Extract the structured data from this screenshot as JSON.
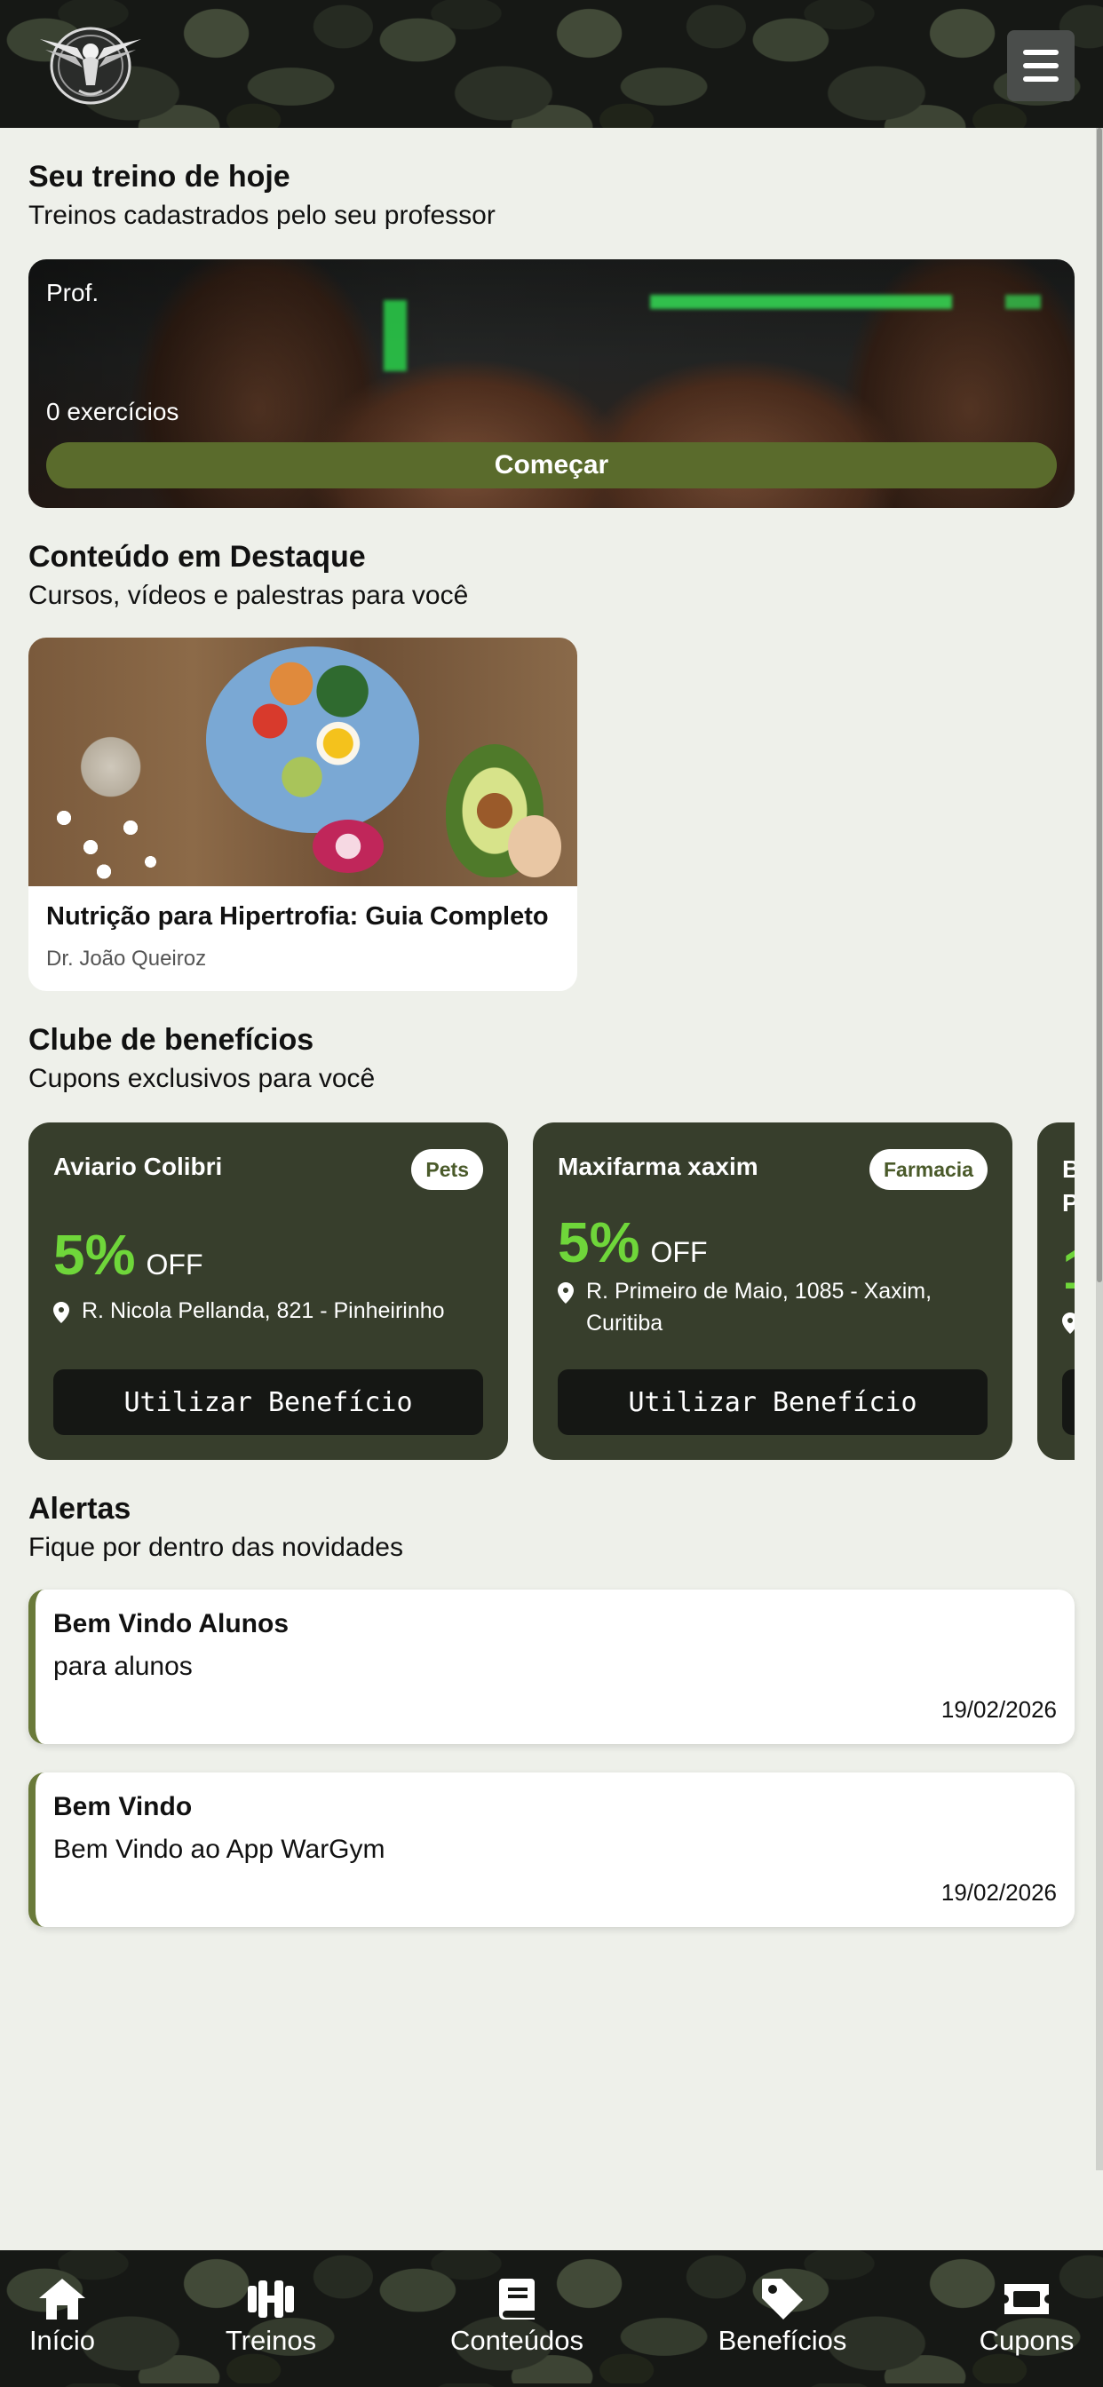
{
  "header": {
    "logo_icon": "eagle-logo-icon",
    "menu_icon": "hamburger-icon"
  },
  "today": {
    "title": "Seu treino de hoje",
    "subtitle": "Treinos cadastrados pelo seu professor",
    "card": {
      "professor": "Prof.",
      "exercises": "0 exercícios",
      "start_label": "Começar"
    }
  },
  "featured": {
    "title": "Conteúdo em Destaque",
    "subtitle": "Cursos, vídeos e palestras para você",
    "items": [
      {
        "title": "Nutrição para Hipertrofia: Guia Completo",
        "author": "Dr. João Queiroz"
      }
    ]
  },
  "benefits": {
    "title": "Clube de benefícios",
    "subtitle": "Cupons exclusivos para você",
    "items": [
      {
        "name": "Aviario Colibri",
        "tag": "Pets",
        "discount": "5%",
        "off": "OFF",
        "address": "R. Nicola Pellanda, 821 - Pinheirinho",
        "button": "Utilizar Benefício"
      },
      {
        "name": "Maxifarma xaxim",
        "tag": "Farmacia",
        "discount": "5%",
        "off": "OFF",
        "address": "R. Primeiro de Maio, 1085 - Xaxim, Curitiba",
        "button": "Utilizar Benefício"
      }
    ],
    "partial_card": {
      "name_line1": "B",
      "name_line2": "P",
      "discount": "1"
    }
  },
  "alerts": {
    "title": "Alertas",
    "subtitle": "Fique por dentro das novidades",
    "items": [
      {
        "title": "Bem Vindo Alunos",
        "message": "para alunos",
        "date": "19/02/2026"
      },
      {
        "title": "Bem Vindo",
        "message": "Bem Vindo ao App WarGym",
        "date": "19/02/2026"
      }
    ]
  },
  "nav": {
    "items": [
      {
        "label": "Início",
        "icon": "home-icon"
      },
      {
        "label": "Treinos",
        "icon": "dumbbell-icon"
      },
      {
        "label": "Conteúdos",
        "icon": "book-icon"
      },
      {
        "label": "Benefícios",
        "icon": "tag-icon"
      },
      {
        "label": "Cupons",
        "icon": "ticket-icon"
      }
    ]
  },
  "colors": {
    "accent_green": "#6fd63a",
    "olive": "#5a6b2c",
    "card_dark": "#373e2c",
    "background": "#eef0ea"
  }
}
